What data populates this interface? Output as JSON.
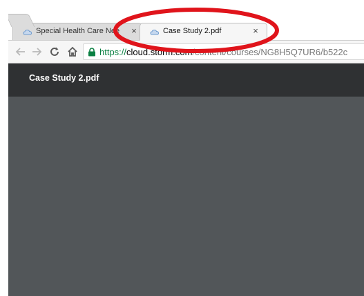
{
  "browser": {
    "tabs": [
      {
        "title": "Special Health Care Nee",
        "favicon": "cloud-icon",
        "active": false,
        "close_label": "×"
      },
      {
        "title": "Case Study 2.pdf",
        "favicon": "cloud-icon",
        "active": true,
        "close_label": "×"
      }
    ],
    "new_tab": "new-tab-icon",
    "toolbar": {
      "back": "back-arrow-icon",
      "forward": "forward-arrow-icon",
      "reload": "reload-icon",
      "home": "home-icon"
    },
    "address_bar": {
      "secure_icon": "lock-icon",
      "url_scheme": "https://",
      "url_host": "cloud.storm.com",
      "url_path": "/content/courses/NG8H5Q7UR6/b522c"
    }
  },
  "app": {
    "title": "Case Study 2.pdf"
  },
  "colors": {
    "header_bg": "#2f3133",
    "viewer_bg": "#525659",
    "secure_green": "#0b8043",
    "annotation_red": "#e0141b"
  },
  "annotation": {
    "shape": "ellipse",
    "color": "#e0141b",
    "target": "tab-case-study"
  }
}
